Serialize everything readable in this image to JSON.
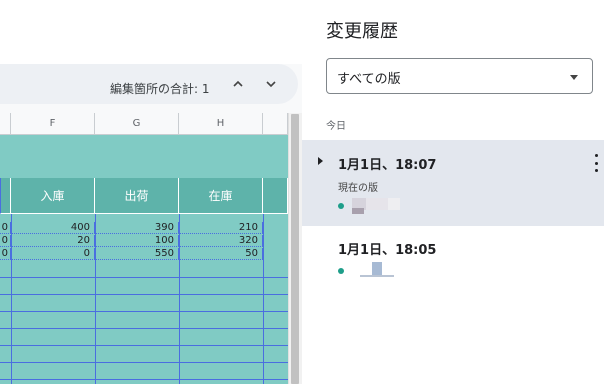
{
  "find_bar": {
    "label": "編集箇所の合計: 1"
  },
  "sheet": {
    "columns": [
      "F",
      "G",
      "H"
    ],
    "headers": [
      "入庫",
      "出荷",
      "在庫"
    ],
    "partial_left": [
      "0",
      "0",
      "0"
    ],
    "rows": [
      [
        "400",
        "390",
        "210"
      ],
      [
        "20",
        "100",
        "320"
      ],
      [
        "0",
        "550",
        "50"
      ]
    ]
  },
  "panel": {
    "title": "変更履歴",
    "dropdown_value": "すべての版",
    "section_today": "今日",
    "versions": [
      {
        "time": "1月1日、18:07",
        "badge": "現在の版"
      },
      {
        "time": "1月1日、18:05"
      }
    ]
  },
  "colors": {
    "teal": "#80cbc4",
    "teal_dark": "#5eb3aa",
    "active_version_bg": "#e3e7ee",
    "dot": "#1e9e8a",
    "edit_border": "#4a6ee0"
  }
}
